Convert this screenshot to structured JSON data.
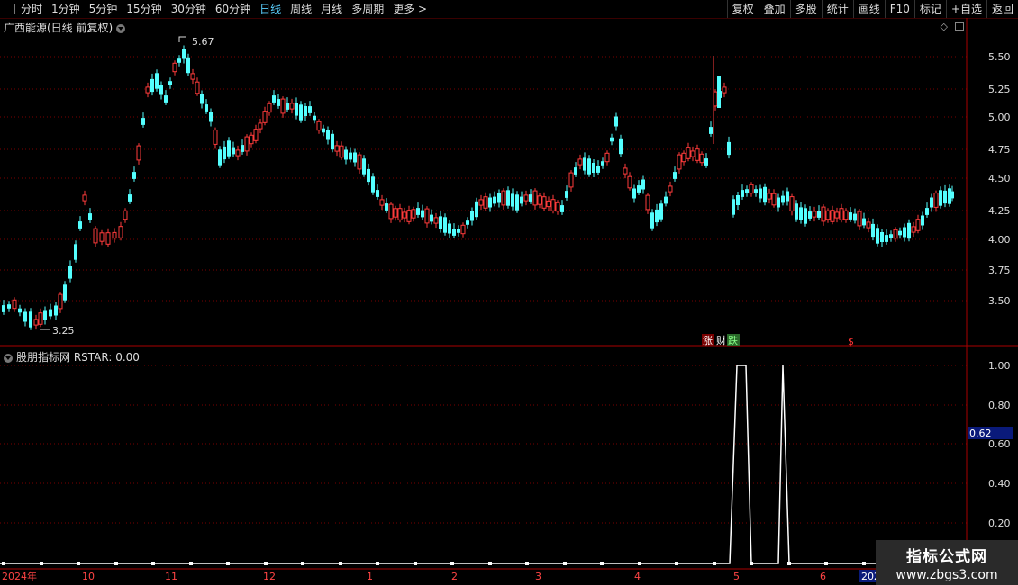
{
  "toolbar": {
    "periods": [
      "分时",
      "1分钟",
      "5分钟",
      "15分钟",
      "30分钟",
      "60分钟",
      "日线",
      "周线",
      "月线",
      "多周期",
      "更多 >"
    ],
    "active_index": 6,
    "right_buttons": [
      "复权",
      "叠加",
      "多股",
      "统计",
      "画线",
      "F10",
      "标记",
      "+自选",
      "返回"
    ]
  },
  "main_chart": {
    "title": "广西能源(日线 前复权)",
    "y_labels": [
      "5.50",
      "5.25",
      "5.00",
      "4.75",
      "4.50",
      "4.25",
      "4.00",
      "3.75",
      "3.50"
    ],
    "high_label": "5.67",
    "low_label": "3.25",
    "events": {
      "a": "涨",
      "b": "财",
      "c": "跌",
      "d": "$"
    },
    "colors": {
      "up": "#ff3b3b",
      "down": "#54ffff",
      "grid": "#7a0000"
    }
  },
  "indicator": {
    "title": "股朋指标网 RSTAR: 0.00",
    "y_labels": [
      "1.00",
      "0.80",
      "0.60",
      "0.40",
      "0.20"
    ],
    "cursor_value": "0.62"
  },
  "x_axis": {
    "labels": [
      "2024年",
      "10",
      "11",
      "12",
      "1",
      "2",
      "3",
      "4",
      "5",
      "6",
      "202"
    ]
  },
  "watermark": {
    "line1": "指标公式网",
    "line2": "www.zbgs3.com"
  }
}
